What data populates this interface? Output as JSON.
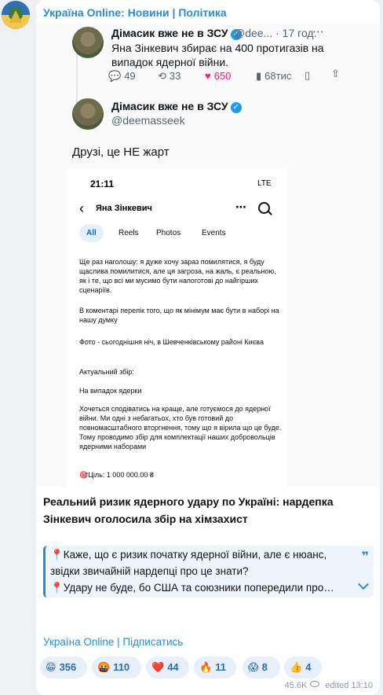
{
  "channel": {
    "name": "Україна Online: Новини | Політика",
    "signature": "Україна Online | Підписатись"
  },
  "tweet_first": {
    "name": "Дімасик вже не в ЗСУ",
    "handle": "@dee... · 17 год.",
    "text_line1": "Яна Зінкевич збирає на 400 протигазів на",
    "text_line2": "випадок ядерної війни.",
    "replies": "49",
    "retweets": "33",
    "likes": "650",
    "views": "68тис"
  },
  "tweet_second": {
    "name": "Дімасик вже не в ЗСУ",
    "handle": "@deemasseek",
    "text": "Друзі, це НЕ жарт"
  },
  "phone": {
    "time": "21:11",
    "status": "LTE",
    "page_title": "Яна Зінкевич",
    "tabs": [
      "All",
      "Reels",
      "Photos",
      "Events"
    ],
    "paragraphs": [
      "Ще раз наголошу: я дуже хочу зараз помилятися, я буду щаслива помилитися, але ця загроза, на жаль, є реальною, як і те, що всі ми мусимо бути напоготові до найгірших сценаріїв.",
      "В коментарі перелік того, що як мінімум має бути в наборі на нашу думку",
      "Фото - сьогоднішня ніч, в Шевченківському районі Києва",
      "Актуальний збір:",
      "На випадок ядерки",
      "Хочеться сподіватись на краще, але готуємося до ядерної війни. Ми одні з небагатьох, хто був готовий до повномасштабного вторгнення, тому що я вірила що це буде. Тому проводимо збір для комплектації наших добровольців ядерними наборами",
      "🎯Ціль: 1 000 000.00 ₴"
    ]
  },
  "caption": "Реальний ризик ядерного удару по Україні: нардепка Зінкевич оголосила збір на хімзахист",
  "quote": {
    "line1": "📍Каже, що є ризик початку ядерної війни, але є нюанс,",
    "line2": "звідки звичайній нардепці про це знати?",
    "line3": "📍Удару не буде, бо США та союзники попередили про…",
    "mark": "❞"
  },
  "reactions": [
    {
      "emoji": "😁",
      "count": "356"
    },
    {
      "emoji": "🤬",
      "count": "110"
    },
    {
      "emoji": "❤️",
      "count": "44"
    },
    {
      "emoji": "🔥",
      "count": "11"
    },
    {
      "emoji": "😱",
      "count": "8"
    },
    {
      "emoji": "👍",
      "count": "4"
    }
  ],
  "footer": {
    "views": "45.6K",
    "edited": "edited",
    "time": "13:10"
  },
  "colors": {
    "accent": "#2b8ad8",
    "like": "#f91880",
    "verified": "#1d9bf0"
  },
  "icons": [
    "reply-icon",
    "retweet-icon",
    "heart-icon",
    "views-icon",
    "bookmark-icon",
    "share-icon",
    "eye-icon",
    "expand-icon"
  ]
}
